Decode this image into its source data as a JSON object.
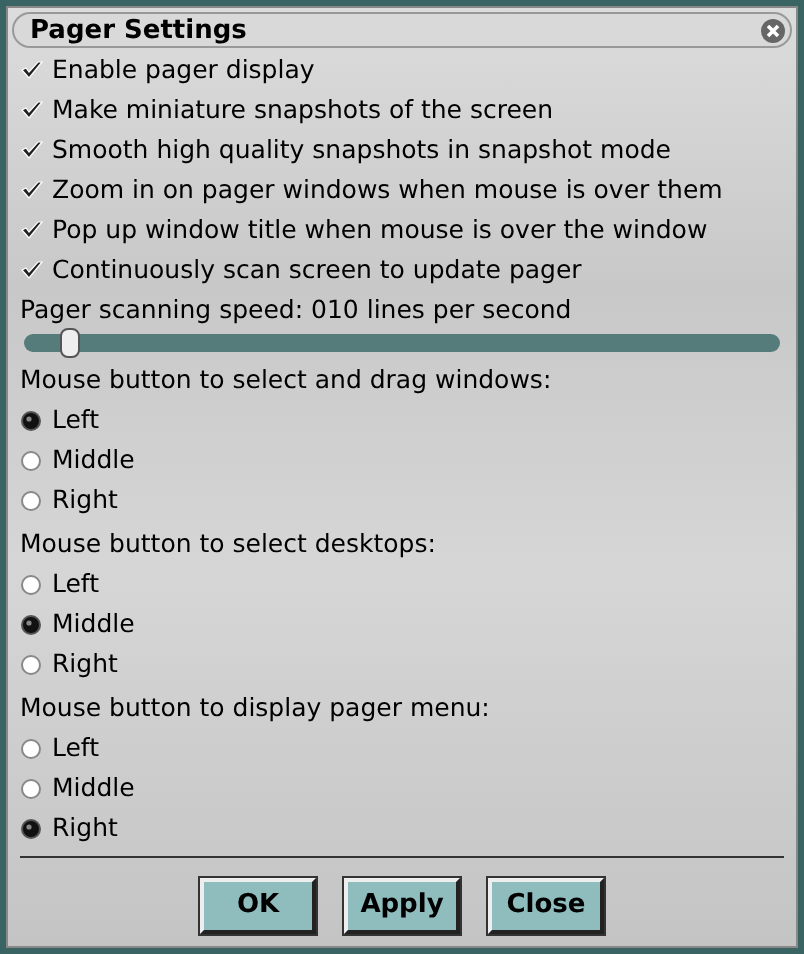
{
  "window": {
    "title": "Pager Settings"
  },
  "options": [
    {
      "label": "Enable pager display",
      "checked": true
    },
    {
      "label": "Make miniature snapshots of the screen",
      "checked": true
    },
    {
      "label": "Smooth high quality snapshots in snapshot mode",
      "checked": true
    },
    {
      "label": "Zoom in on pager windows when mouse is over them",
      "checked": true
    },
    {
      "label": "Pop up window title when mouse is over the window",
      "checked": true
    },
    {
      "label": "Continuously scan screen to update pager",
      "checked": true
    }
  ],
  "speed": {
    "label": "Pager scanning speed: 010 lines per second",
    "level": 0.06
  },
  "groups": [
    {
      "label": "Mouse button to select and drag windows:",
      "choices": [
        {
          "label": "Left",
          "selected": true
        },
        {
          "label": "Middle",
          "selected": false
        },
        {
          "label": "Right",
          "selected": false
        }
      ]
    },
    {
      "label": "Mouse button to select desktops:",
      "choices": [
        {
          "label": "Left",
          "selected": false
        },
        {
          "label": "Middle",
          "selected": true
        },
        {
          "label": "Right",
          "selected": false
        }
      ]
    },
    {
      "label": "Mouse button to display pager menu:",
      "choices": [
        {
          "label": "Left",
          "selected": false
        },
        {
          "label": "Middle",
          "selected": false
        },
        {
          "label": "Right",
          "selected": true
        }
      ]
    }
  ],
  "buttons": [
    "OK",
    "Apply",
    "Close"
  ]
}
